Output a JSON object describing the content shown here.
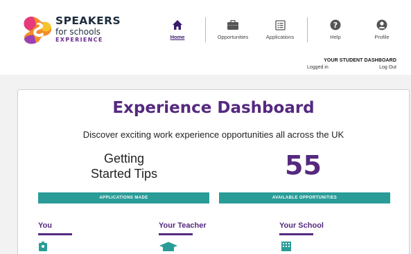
{
  "logo": {
    "line1": "SPEAKERS",
    "line2": "for schools",
    "line3": "EXPERIENCE"
  },
  "nav": {
    "home": "Home",
    "opportunities": "Opportunities",
    "applications": "Applications",
    "help": "Help",
    "profile": "Profile"
  },
  "account": {
    "dashboard_title": "YOUR STUDENT DASHBOARD",
    "logged_in": "Logged in",
    "logout": "Log Out"
  },
  "main": {
    "title": "Experience Dashboard",
    "subtitle": "Discover exciting work experience opportunities all across the UK",
    "tips_line1": "Getting",
    "tips_line2": "Started Tips",
    "count": "55",
    "applications_bar": "APPLICATIONS MADE",
    "opportunities_bar": "AVAILABLE OPPORTUNITIES"
  },
  "sections": {
    "you": "You",
    "teacher": "Your Teacher",
    "school": "Your School"
  },
  "colors": {
    "brand_purple": "#55297f",
    "teal": "#2a9c98",
    "dark_navy": "#1e2d3d"
  },
  "icons": {
    "home": "home-icon",
    "opportunities": "briefcase-icon",
    "applications": "list-icon",
    "help": "question-icon",
    "profile": "user-icon",
    "you": "id-badge-icon",
    "teacher": "graduation-cap-icon",
    "school": "building-icon"
  }
}
